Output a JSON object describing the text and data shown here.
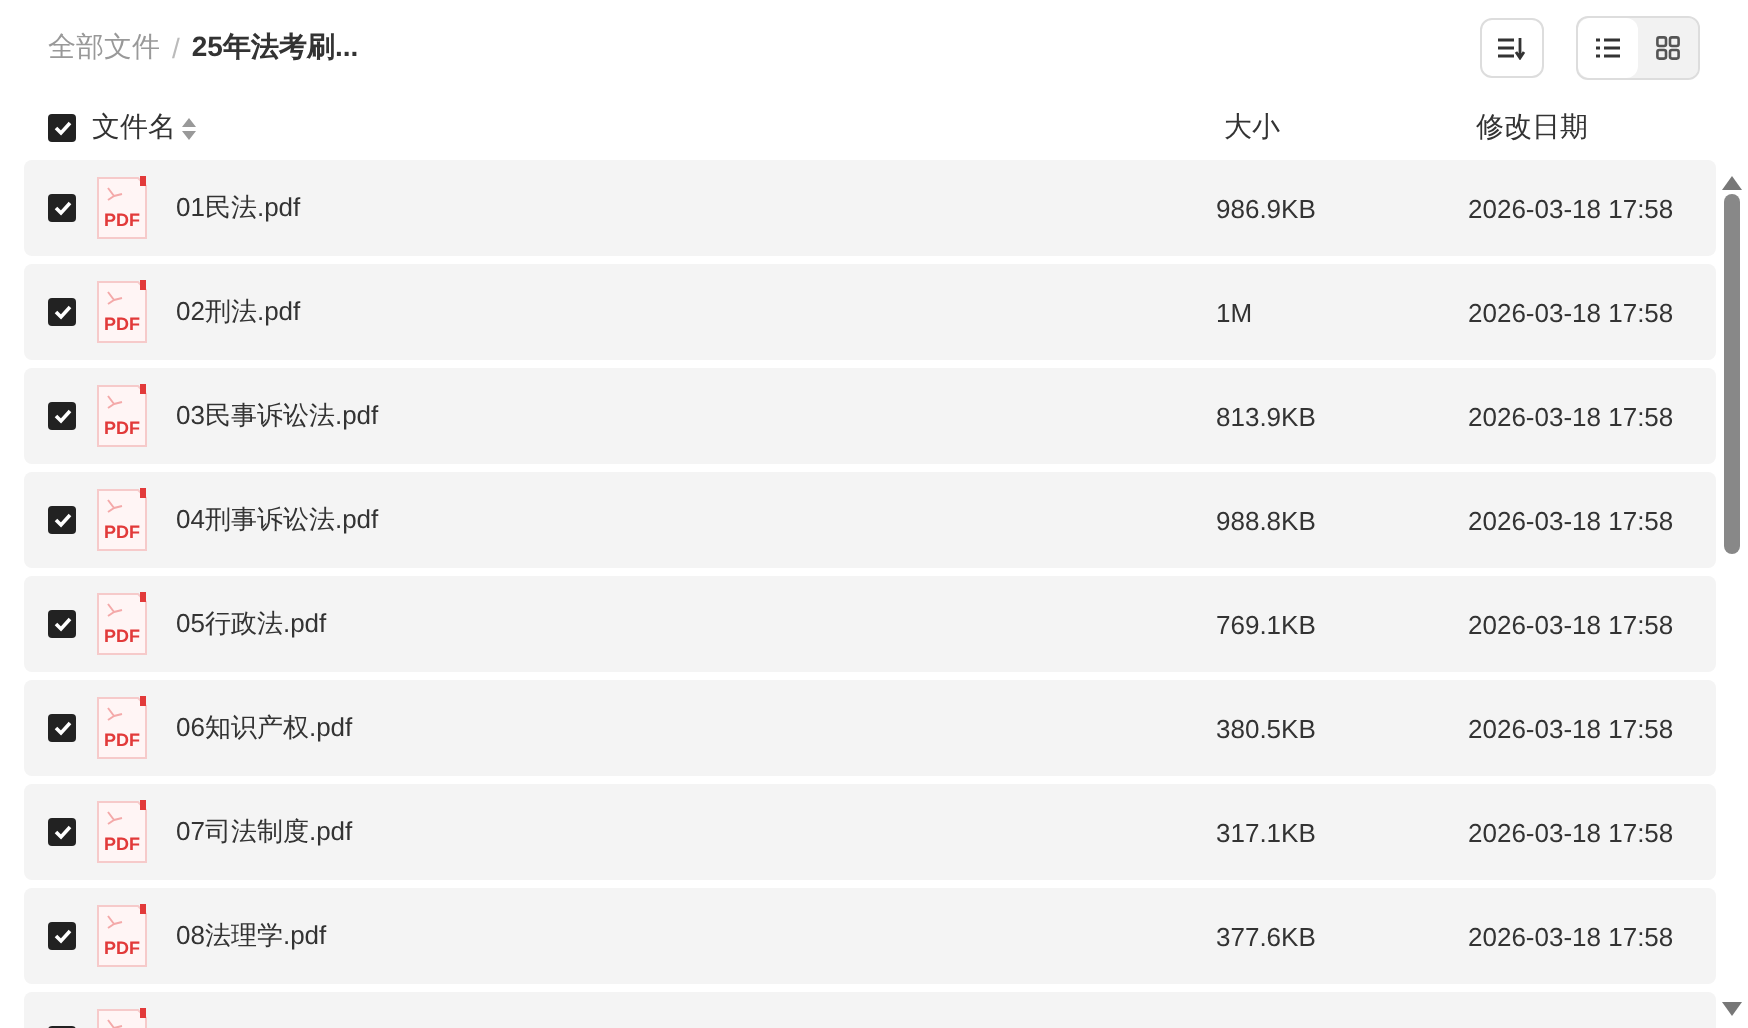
{
  "breadcrumb_separator": "/",
  "breadcrumb": [
    {
      "label": "全部文件",
      "current": false
    },
    {
      "label": "25年法考刷...",
      "current": true
    }
  ],
  "view_modes": [
    {
      "kind": "list",
      "selected": true
    },
    {
      "kind": "grid",
      "selected": false
    }
  ],
  "header": {
    "checked": true,
    "columns": [
      "文件名",
      "大小",
      "修改日期"
    ]
  },
  "rows": [
    {
      "checked": true,
      "icon_label": "PDF",
      "name": "01民法.pdf",
      "size": "986.9KB",
      "date": "2026-03-18 17:58"
    },
    {
      "checked": true,
      "icon_label": "PDF",
      "name": "02刑法.pdf",
      "size": "1M",
      "date": "2026-03-18 17:58"
    },
    {
      "checked": true,
      "icon_label": "PDF",
      "name": "03民事诉讼法.pdf",
      "size": "813.9KB",
      "date": "2026-03-18 17:58"
    },
    {
      "checked": true,
      "icon_label": "PDF",
      "name": "04刑事诉讼法.pdf",
      "size": "988.8KB",
      "date": "2026-03-18 17:58"
    },
    {
      "checked": true,
      "icon_label": "PDF",
      "name": "05行政法.pdf",
      "size": "769.1KB",
      "date": "2026-03-18 17:58"
    },
    {
      "checked": true,
      "icon_label": "PDF",
      "name": "06知识产权.pdf",
      "size": "380.5KB",
      "date": "2026-03-18 17:58"
    },
    {
      "checked": true,
      "icon_label": "PDF",
      "name": "07司法制度.pdf",
      "size": "317.1KB",
      "date": "2026-03-18 17:58"
    },
    {
      "checked": true,
      "icon_label": "PDF",
      "name": "08法理学.pdf",
      "size": "377.6KB",
      "date": "2026-03-18 17:58"
    },
    {
      "checked": true
    }
  ]
}
